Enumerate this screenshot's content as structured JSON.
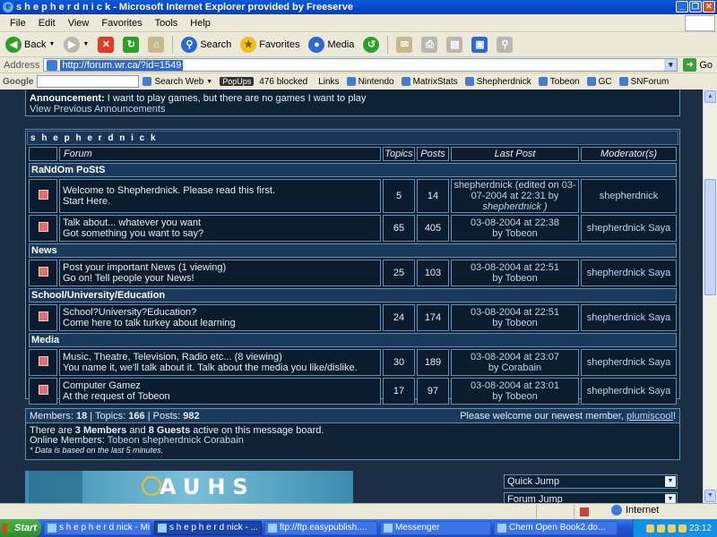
{
  "window": {
    "title": "s h e p h e r d n i c k - Microsoft Internet Explorer provided by Freeserve"
  },
  "menu": [
    "File",
    "Edit",
    "View",
    "Favorites",
    "Tools",
    "Help"
  ],
  "toolbar": {
    "back": "Back",
    "search": "Search",
    "favorites": "Favorites",
    "media": "Media"
  },
  "address": {
    "label": "Address",
    "url": "http://forum.wr.ca/?id=1549",
    "go": "Go"
  },
  "googlebar": {
    "logo": "Google",
    "search_web": "Search Web",
    "popups": "PopUps",
    "blocked": "476 blocked",
    "links_label": "Links",
    "links": [
      "Nintendo",
      "MatrixStats",
      "Shepherdnick",
      "Tobeon",
      "GC",
      "SNForum"
    ]
  },
  "announcement": {
    "label": "Announcement:",
    "text": "I want to play games, but there are no games I want to play",
    "link": "View Previous Announcements"
  },
  "forum": {
    "title": "s h e p h e r d n i c k",
    "headers": {
      "forum": "Forum",
      "topics": "Topics",
      "posts": "Posts",
      "last": "Last Post",
      "mod": "Moderator(s)"
    },
    "categories": [
      {
        "name": "RaNdOm PoStS",
        "rows": [
          {
            "title": "Welcome to Shepherdnick. Please read this first.",
            "desc": "Start Here.",
            "topics": "5",
            "posts": "14",
            "last1": "shepherdnick (edited on 03-07-2004 at 22:31 by",
            "last2": "shepherdnick )",
            "mods": "shepherdnick"
          },
          {
            "title": "Talk about... whatever you want",
            "desc": "Got something you want to say?",
            "topics": "65",
            "posts": "405",
            "last1": "03-08-2004 at 22:38",
            "last2": "by Tobeon",
            "mods": "shepherdnick  Saya"
          }
        ]
      },
      {
        "name": "News",
        "rows": [
          {
            "title": "Post your important News   (1 viewing)",
            "desc": "Go on! Tell people your News!",
            "topics": "25",
            "posts": "103",
            "last1": "03-08-2004 at 22:51",
            "last2": "by Tobeon",
            "mods": "shepherdnick  Saya"
          }
        ]
      },
      {
        "name": "School/University/Education",
        "rows": [
          {
            "title": "School?University?Education?",
            "desc": "Come here to talk turkey about learning",
            "topics": "24",
            "posts": "174",
            "last1": "03-08-2004 at 22:51",
            "last2": "by Tobeon",
            "mods": "shepherdnick  Saya"
          }
        ]
      },
      {
        "name": "Media",
        "rows": [
          {
            "title": "Music, Theatre, Television, Radio etc...   (8 viewing)",
            "desc": "You name it, we'll talk about it. Talk about the media you like/dislike.",
            "topics": "30",
            "posts": "189",
            "last1": "03-08-2004 at 23:07",
            "last2": "by Corabain",
            "mods": "shepherdnick  Saya"
          },
          {
            "title": "Computer Gamez",
            "desc": "At the request of Tobeon",
            "topics": "17",
            "posts": "97",
            "last1": "03-08-2004 at 23:01",
            "last2": "by Tobeon",
            "mods": "shepherdnick  Saya"
          }
        ]
      }
    ]
  },
  "stats": {
    "members_label": "Members:",
    "members": "18",
    "topics_label": "Topics:",
    "topics": "166",
    "posts_label": "Posts:",
    "posts": "982",
    "welcome": "Please welcome our newest member,",
    "newest": "plumiscool",
    "active_pre": "There are",
    "active_members": "3 Members",
    "active_and": "and",
    "active_guests": "8 Guests",
    "active_post": "active on this message board.",
    "online_label": "Online Members:",
    "online": "Tobeon  shepherdnick  Corabain",
    "note": "* Data is based on the last 5 minutes."
  },
  "banner": {
    "text": "AUHS"
  },
  "jumps": [
    "Quick Jump",
    "Forum Jump"
  ],
  "status": {
    "zone": "Internet"
  },
  "taskbar": {
    "start": "Start",
    "tasks": [
      "s h e p h e r d nick - Mi...",
      "s h e p h e r d nick - ...",
      "ftp://ftp.easypublish....",
      "Messenger",
      "Chem Open Book2.do..."
    ],
    "clock": "23:12"
  }
}
